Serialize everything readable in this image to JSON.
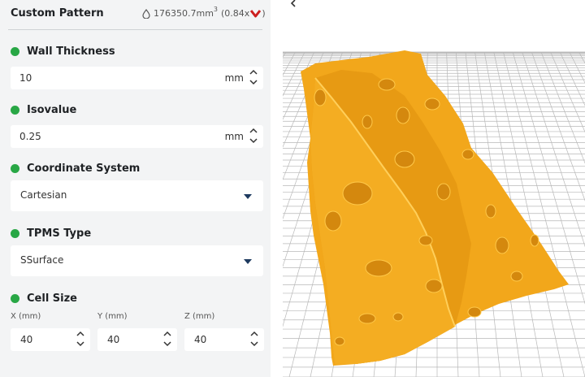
{
  "panel": {
    "title": "Custom Pattern",
    "volume": {
      "value": "176350.7mm",
      "sup": "3",
      "ratio": "(0.84x",
      "close": ")",
      "heart_icon": "heart-icon"
    }
  },
  "wall_thickness": {
    "label": "Wall Thickness",
    "value": "10",
    "unit": "mm"
  },
  "isovalue": {
    "label": "Isovalue",
    "value": "0.25",
    "unit": "mm"
  },
  "coordinate_system": {
    "label": "Coordinate System",
    "value": "Cartesian"
  },
  "tpms_type": {
    "label": "TPMS Type",
    "value": "SSurface"
  },
  "cell_size": {
    "label": "Cell Size",
    "x": {
      "label": "X (mm)",
      "value": "40"
    },
    "y": {
      "label": "Y (mm)",
      "value": "40"
    },
    "z": {
      "label": "Z (mm)",
      "value": "40"
    }
  },
  "colors": {
    "status_dot": "#28a745",
    "model": "#f2a71b",
    "grid": "#b5b5b5"
  },
  "viewport": {
    "back_icon": "chevron-left-icon"
  }
}
